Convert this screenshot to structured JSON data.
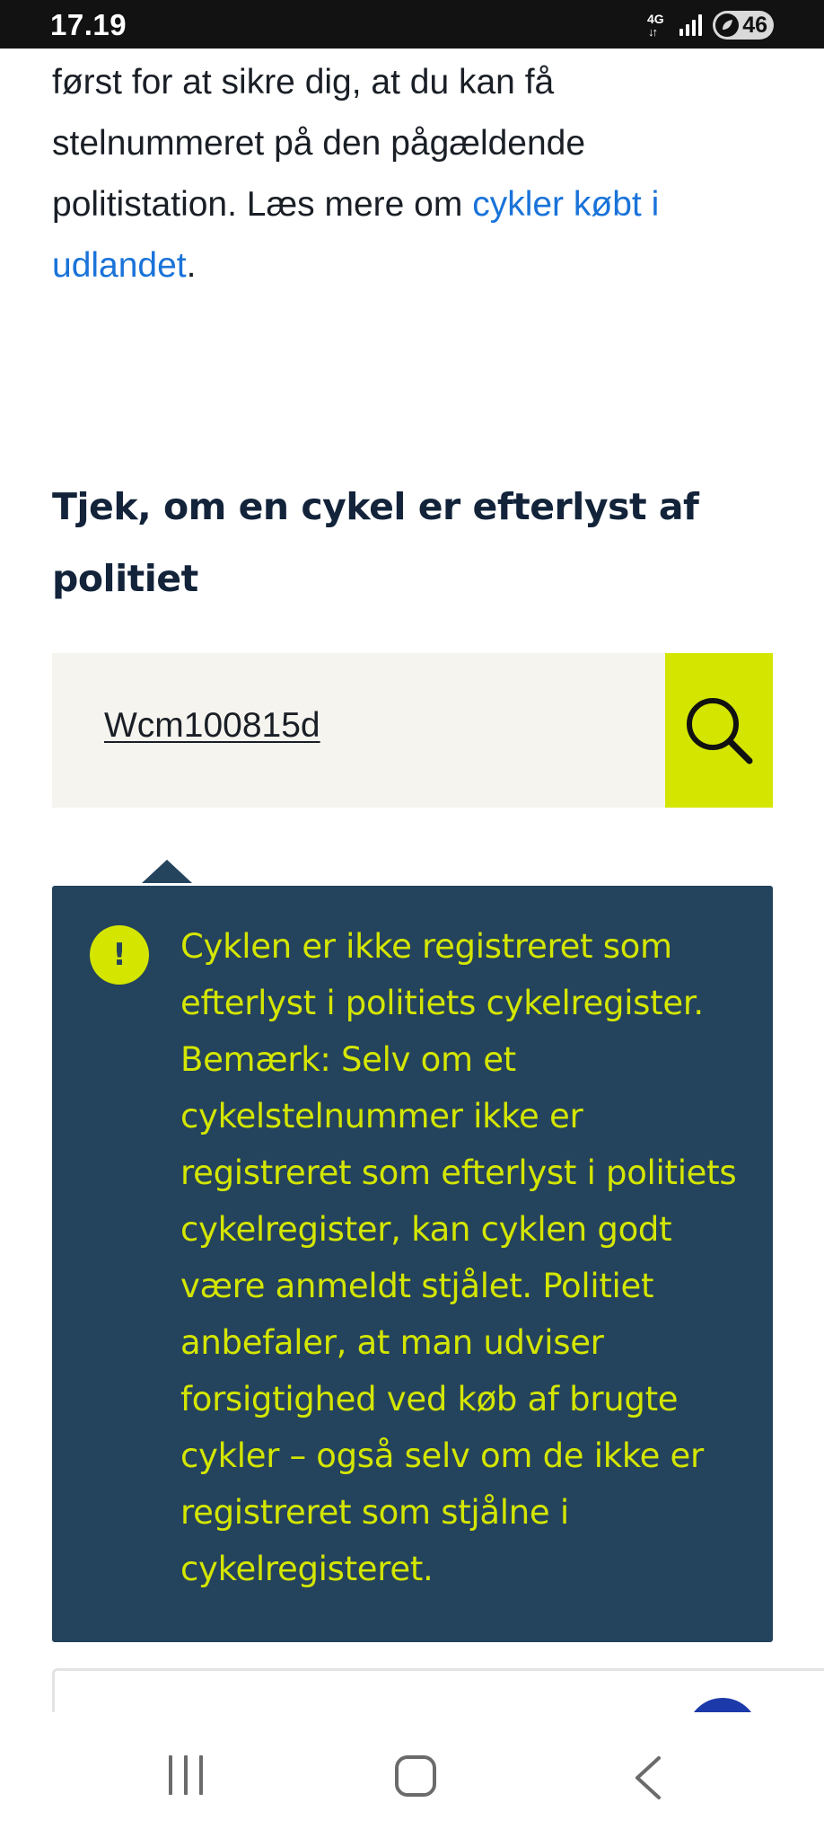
{
  "status_bar": {
    "time": "17.19",
    "network_type": "4G",
    "battery_level": "46"
  },
  "intro": {
    "text_before_link": "først for at sikre dig, at du kan få stelnummeret på den pågældende politistation. Læs mere om ",
    "link_text": "cykler købt i udlandet",
    "text_after_link": "."
  },
  "section": {
    "title": "Tjek, om en cykel er efterlyst af politiet"
  },
  "search": {
    "value": "Wcm100815d",
    "button_icon": "search-icon"
  },
  "result": {
    "icon_symbol": "!",
    "message": "Cyklen er ikke registreret som efterlyst i politiets cykelregister. Bemærk: Selv om et cykelstelnummer ikke er registreret som efterlyst i politiets cykelregister, kan cyklen godt være anmeldt stjålet. Politiet anbefaler, at man udviser forsigtighed ved køb af brugte cykler – også selv om de ikke er registreret som stjålne i cykelregisteret."
  },
  "colors": {
    "accent": "#d4e600",
    "panel": "#24435d",
    "link": "#1a73d9",
    "search_field": "#f6f4ef"
  },
  "nav_bar": {
    "icons": [
      "recents-icon",
      "home-icon",
      "back-icon"
    ]
  }
}
